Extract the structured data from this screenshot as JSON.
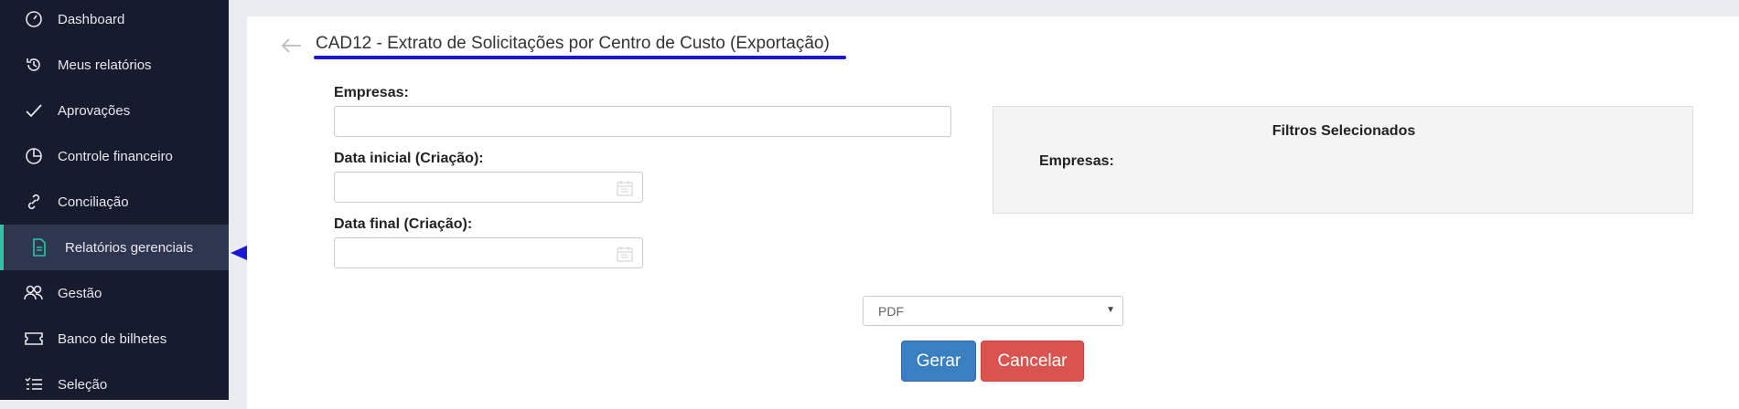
{
  "sidebar": {
    "items": [
      {
        "label": "Dashboard",
        "icon": "speedometer-icon",
        "active": false
      },
      {
        "label": "Meus relatórios",
        "icon": "history-icon",
        "active": false
      },
      {
        "label": "Aprovações",
        "icon": "check-icon",
        "active": false
      },
      {
        "label": "Controle financeiro",
        "icon": "pie-chart-icon",
        "active": false
      },
      {
        "label": "Conciliação",
        "icon": "link-icon",
        "active": false
      },
      {
        "label": "Relatórios gerenciais",
        "icon": "document-icon",
        "active": true
      },
      {
        "label": "Gestão",
        "icon": "users-icon",
        "active": false
      },
      {
        "label": "Banco de bilhetes",
        "icon": "ticket-icon",
        "active": false
      },
      {
        "label": "Seleção",
        "icon": "list-icon",
        "active": false
      }
    ],
    "active_accent": "#2ec4a6"
  },
  "page": {
    "title": "CAD12 - Extrato de Solicitações por Centro de Custo (Exportação)"
  },
  "form": {
    "empresas_label": "Empresas:",
    "empresas_value": "",
    "data_inicial_label": "Data inicial (Criação):",
    "data_inicial_value": "",
    "data_final_label": "Data final (Criação):",
    "data_final_value": "",
    "format_selected": "PDF"
  },
  "filters": {
    "title": "Filtros Selecionados",
    "empresas_label": "Empresas:"
  },
  "actions": {
    "gerar_label": "Gerar",
    "cancelar_label": "Cancelar"
  },
  "colors": {
    "sidebar_bg": "#161b2e",
    "annotation_blue": "#1a18d6",
    "primary_button": "#3a7fc1",
    "danger_button": "#d9534f"
  }
}
